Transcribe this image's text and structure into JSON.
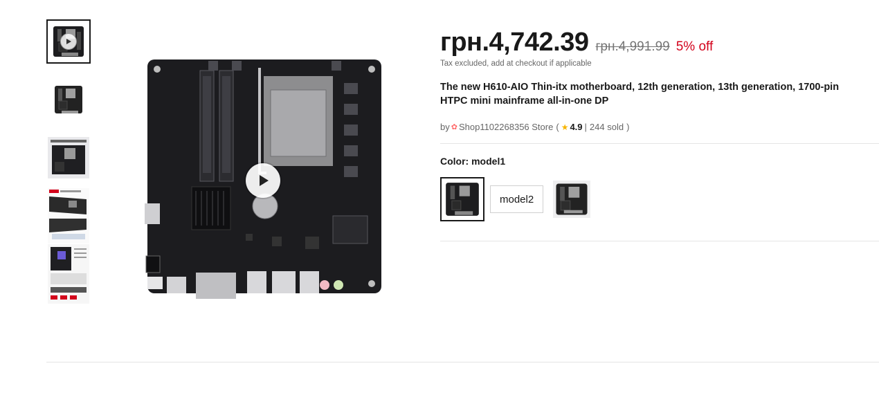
{
  "gallery": {
    "thumbnails": [
      "video-thumb",
      "board-top",
      "board-spec-sheet",
      "board-angle-photos",
      "board-detail-sheet"
    ]
  },
  "price": {
    "current": "грн.4,742.39",
    "original": "грн.4,991.99",
    "discount": "5% off",
    "tax_note": "Tax excluded, add at checkout if applicable"
  },
  "product": {
    "title": "The new H610-AIO Thin-itx motherboard, 12th generation, 13th generation, 1700-pin HTPC mini mainframe all-in-one DP"
  },
  "store": {
    "by": "by",
    "name": "Shop1102268356 Store",
    "open_paren": "(",
    "rating": "4.9",
    "separator": "|",
    "sold": "244 sold",
    "close_paren": ")"
  },
  "variant": {
    "label": "Color: model1",
    "options": [
      "model1",
      "model2",
      "model3"
    ],
    "text_option": "model2"
  },
  "colors": {
    "accent_red": "#d3031c",
    "text": "#191919",
    "muted": "#757575",
    "star": "#f7b500"
  }
}
